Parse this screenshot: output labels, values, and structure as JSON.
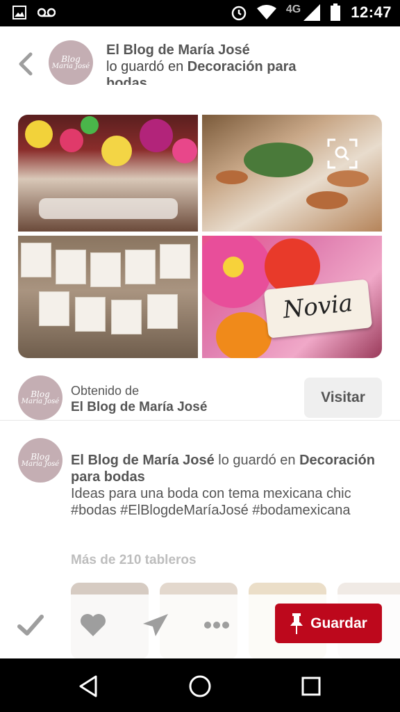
{
  "status_bar": {
    "network": "4G",
    "time": "12:47",
    "icons": [
      "image-icon",
      "voicemail-icon",
      "alarm-icon",
      "wifi-icon",
      "signal-icon",
      "battery-icon"
    ]
  },
  "header": {
    "back_icon": "chevron-left-icon",
    "avatar_text_line1": "Blog",
    "avatar_text_line2": "María José",
    "user_name": "El Blog de María José",
    "saved_in_text": "lo guardó en",
    "board_name": "Decoración para bodas"
  },
  "pin_images": [
    {
      "name": "paper-flowers-reception",
      "icon": "lens-icon"
    },
    {
      "name": "table-setting"
    },
    {
      "name": "papel-picado-banners"
    },
    {
      "name": "novia-sign-flowers",
      "sign_text": "Novia"
    }
  ],
  "source": {
    "label": "Obtenido de",
    "site": "El Blog de María José",
    "visit_label": "Visitar"
  },
  "description": {
    "user_name": "El Blog de María José",
    "saved_in_text": "lo guardó en",
    "board_name": "Decoración para bodas",
    "body": "Ideas para una boda con tema mexicana chic #bodas #ElBlogdeMaríaJosé #bodamexicana",
    "boards_count": "Más de 210 tableros"
  },
  "action_bar": {
    "icons": [
      "check-icon",
      "heart-icon",
      "send-icon",
      "more-icon"
    ],
    "save_label": "Guardar",
    "save_icon": "pin-icon",
    "accent": "#bd081c"
  },
  "nav_bar": {
    "icons": [
      "back-triangle-icon",
      "home-circle-icon",
      "recents-square-icon"
    ]
  }
}
